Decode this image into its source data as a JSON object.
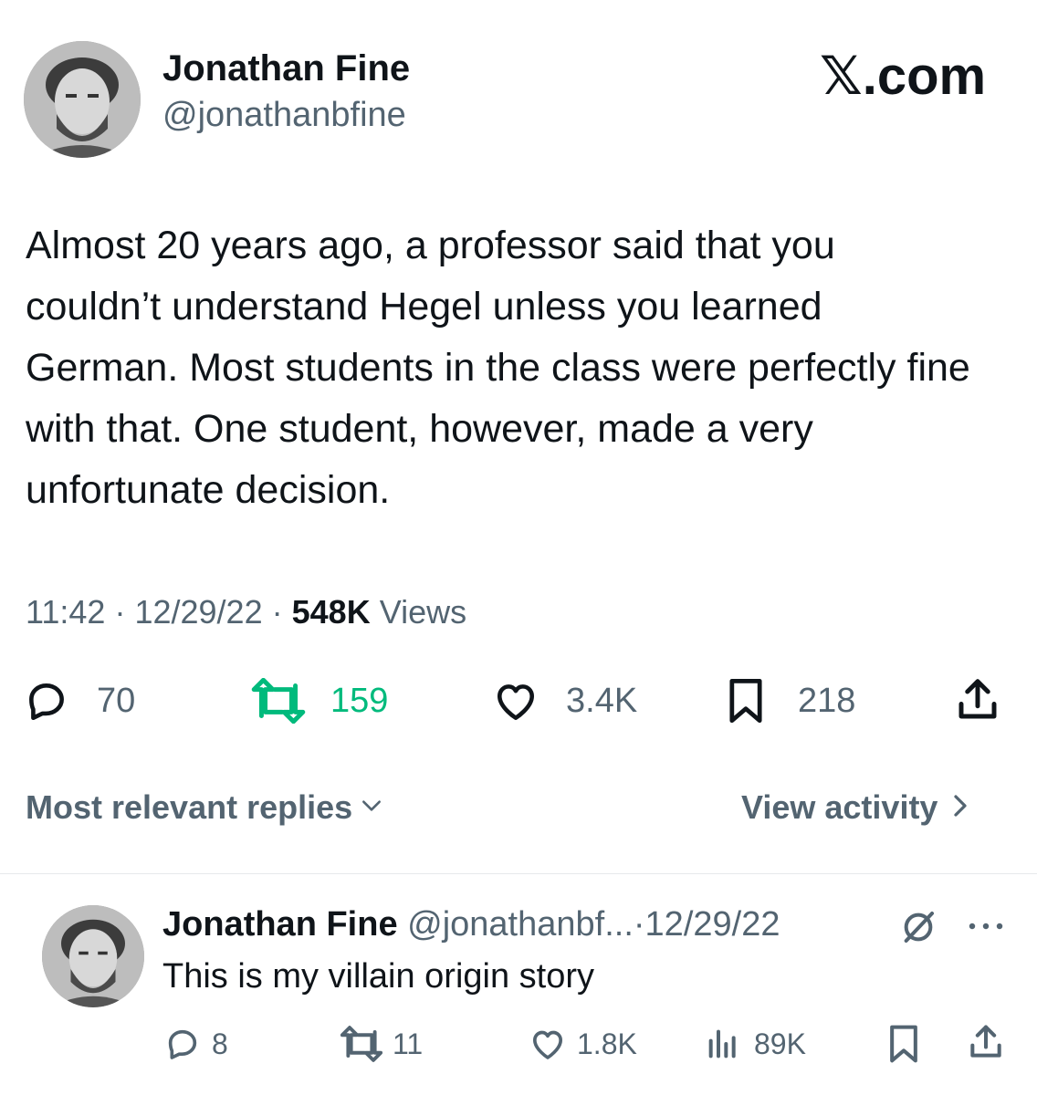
{
  "brand": {
    "x_mark": "𝕏",
    "domain": ".com"
  },
  "main_tweet": {
    "author_name": "Jonathan Fine",
    "author_handle": "@jonathanbfine",
    "text": "Almost 20 years ago, a professor said that you couldn’t understand Hegel unless you learned German. Most students in the class were perfectly fine with that. One student, however, made a very unfortunate decision.",
    "time": "11:42",
    "date": "12/29/22",
    "views_count": "548K",
    "views_label": "Views",
    "separator": "·",
    "stats": {
      "replies": "70",
      "retweets": "159",
      "likes": "3.4K",
      "bookmarks": "218"
    }
  },
  "replies_bar": {
    "sort_label": "Most relevant replies",
    "view_activity_label": "View activity"
  },
  "reply_tweet": {
    "author_name": "Jonathan Fine",
    "author_handle": "@jonathanbf...",
    "separator": "·",
    "date": "12/29/22",
    "text": "This is my villain origin story",
    "stats": {
      "replies": "8",
      "retweets": "11",
      "likes": "1.8K",
      "views": "89K"
    }
  },
  "colors": {
    "text_primary": "#0f1419",
    "text_secondary": "#536471",
    "retweet_active": "#00ba7c",
    "divider": "#e6e9ec"
  },
  "icons": [
    "reply-icon",
    "retweet-icon",
    "like-icon",
    "bookmark-icon",
    "share-icon",
    "views-icon",
    "grok-icon",
    "more-icon",
    "chevron-down-icon",
    "chevron-right-icon"
  ]
}
